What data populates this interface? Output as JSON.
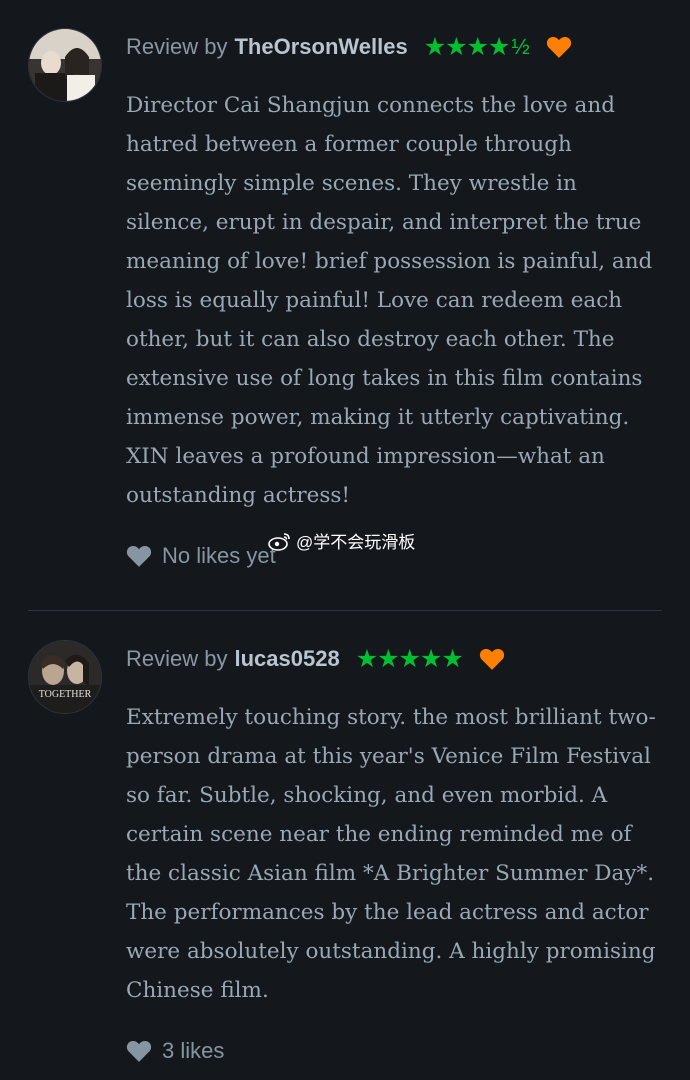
{
  "reviews": [
    {
      "label": "Review by",
      "username": "TheOrsonWelles",
      "stars": "★★★★",
      "half_star": "½",
      "body": "Director Cai Shangjun connects the love and hatred between a former couple through seemingly simple scenes. They wrestle in silence, erupt in despair, and interpret the true meaning of love!  brief possession is painful, and loss is equally painful!  Love can redeem each other, but it can also destroy each other. The extensive use of long takes in this film contains immense power, making it utterly captivating. XIN leaves a profound impression—what an outstanding actress!",
      "likes": "No likes yet",
      "rating": 4.5
    },
    {
      "label": "Review by",
      "username": "lucas0528",
      "stars": "★★★★★",
      "half_star": "",
      "body": "Extremely touching story. the most brilliant two-person drama at this year's Venice Film Festival so far. Subtle, shocking, and even morbid. A certain scene near the ending reminded me of the classic Asian film *A Brighter Summer Day*. The performances by the lead actress and actor were absolutely outstanding. A highly promising Chinese film.",
      "likes": "3 likes",
      "avatar_text": "TOGETHER",
      "rating": 5
    }
  ],
  "watermark": "@学不会玩滑板",
  "colors": {
    "background": "#14181c",
    "star_green": "#00c030",
    "heart_orange": "#ff8000",
    "text": "#9aa8b6"
  },
  "icons": [
    "heart-icon",
    "like-heart-icon",
    "weibo-icon",
    "star-icon"
  ]
}
